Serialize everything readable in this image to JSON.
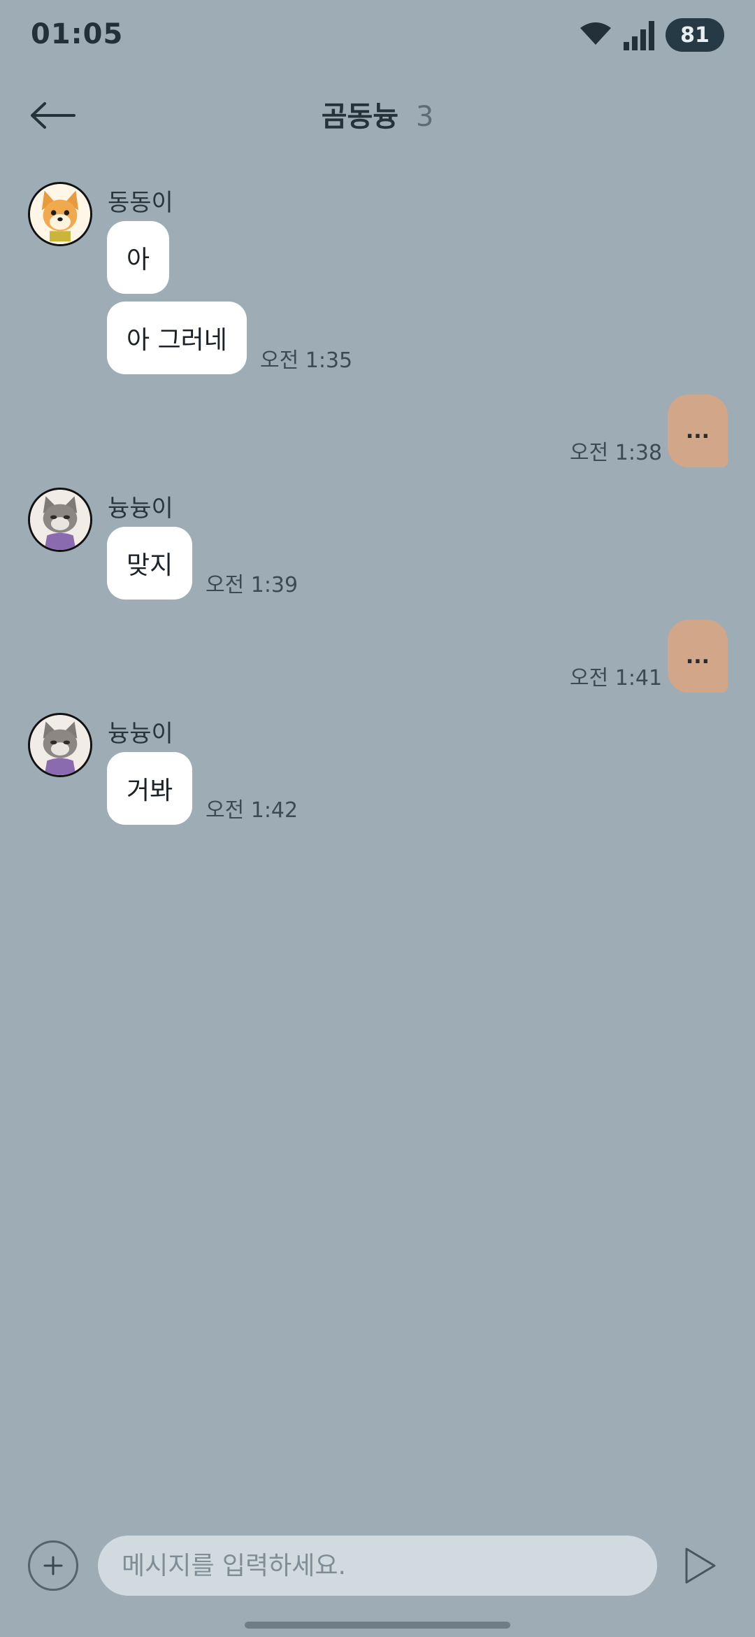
{
  "status": {
    "time": "01:05",
    "battery": "81",
    "wifi_icon": "wifi-icon",
    "signal_icon": "signal-icon"
  },
  "header": {
    "back_icon": "back-arrow-icon",
    "title": "곰동늉",
    "member_count": "3"
  },
  "messages": [
    {
      "sender": "동동이",
      "avatar": "dog-avatar",
      "bubbles": [
        "아",
        "아 그러네"
      ],
      "time": "오전 1:35"
    },
    {
      "mine": true,
      "text": "...",
      "time": "오전 1:38"
    },
    {
      "sender": "늉늉이",
      "avatar": "cat-avatar",
      "bubbles": [
        "맞지"
      ],
      "time": "오전 1:39"
    },
    {
      "mine": true,
      "text": "...",
      "time": "오전 1:41"
    },
    {
      "sender": "늉늉이",
      "avatar": "cat-avatar",
      "bubbles": [
        "거봐"
      ],
      "time": "오전 1:42"
    }
  ],
  "composer": {
    "placeholder": "메시지를 입력하세요.",
    "plus_icon": "plus-icon",
    "send_icon": "send-icon"
  },
  "colors": {
    "background": "#9eacb5",
    "my_bubble": "#d1a689",
    "their_bubble": "#ffffff",
    "input_bg": "#d1dadf"
  }
}
